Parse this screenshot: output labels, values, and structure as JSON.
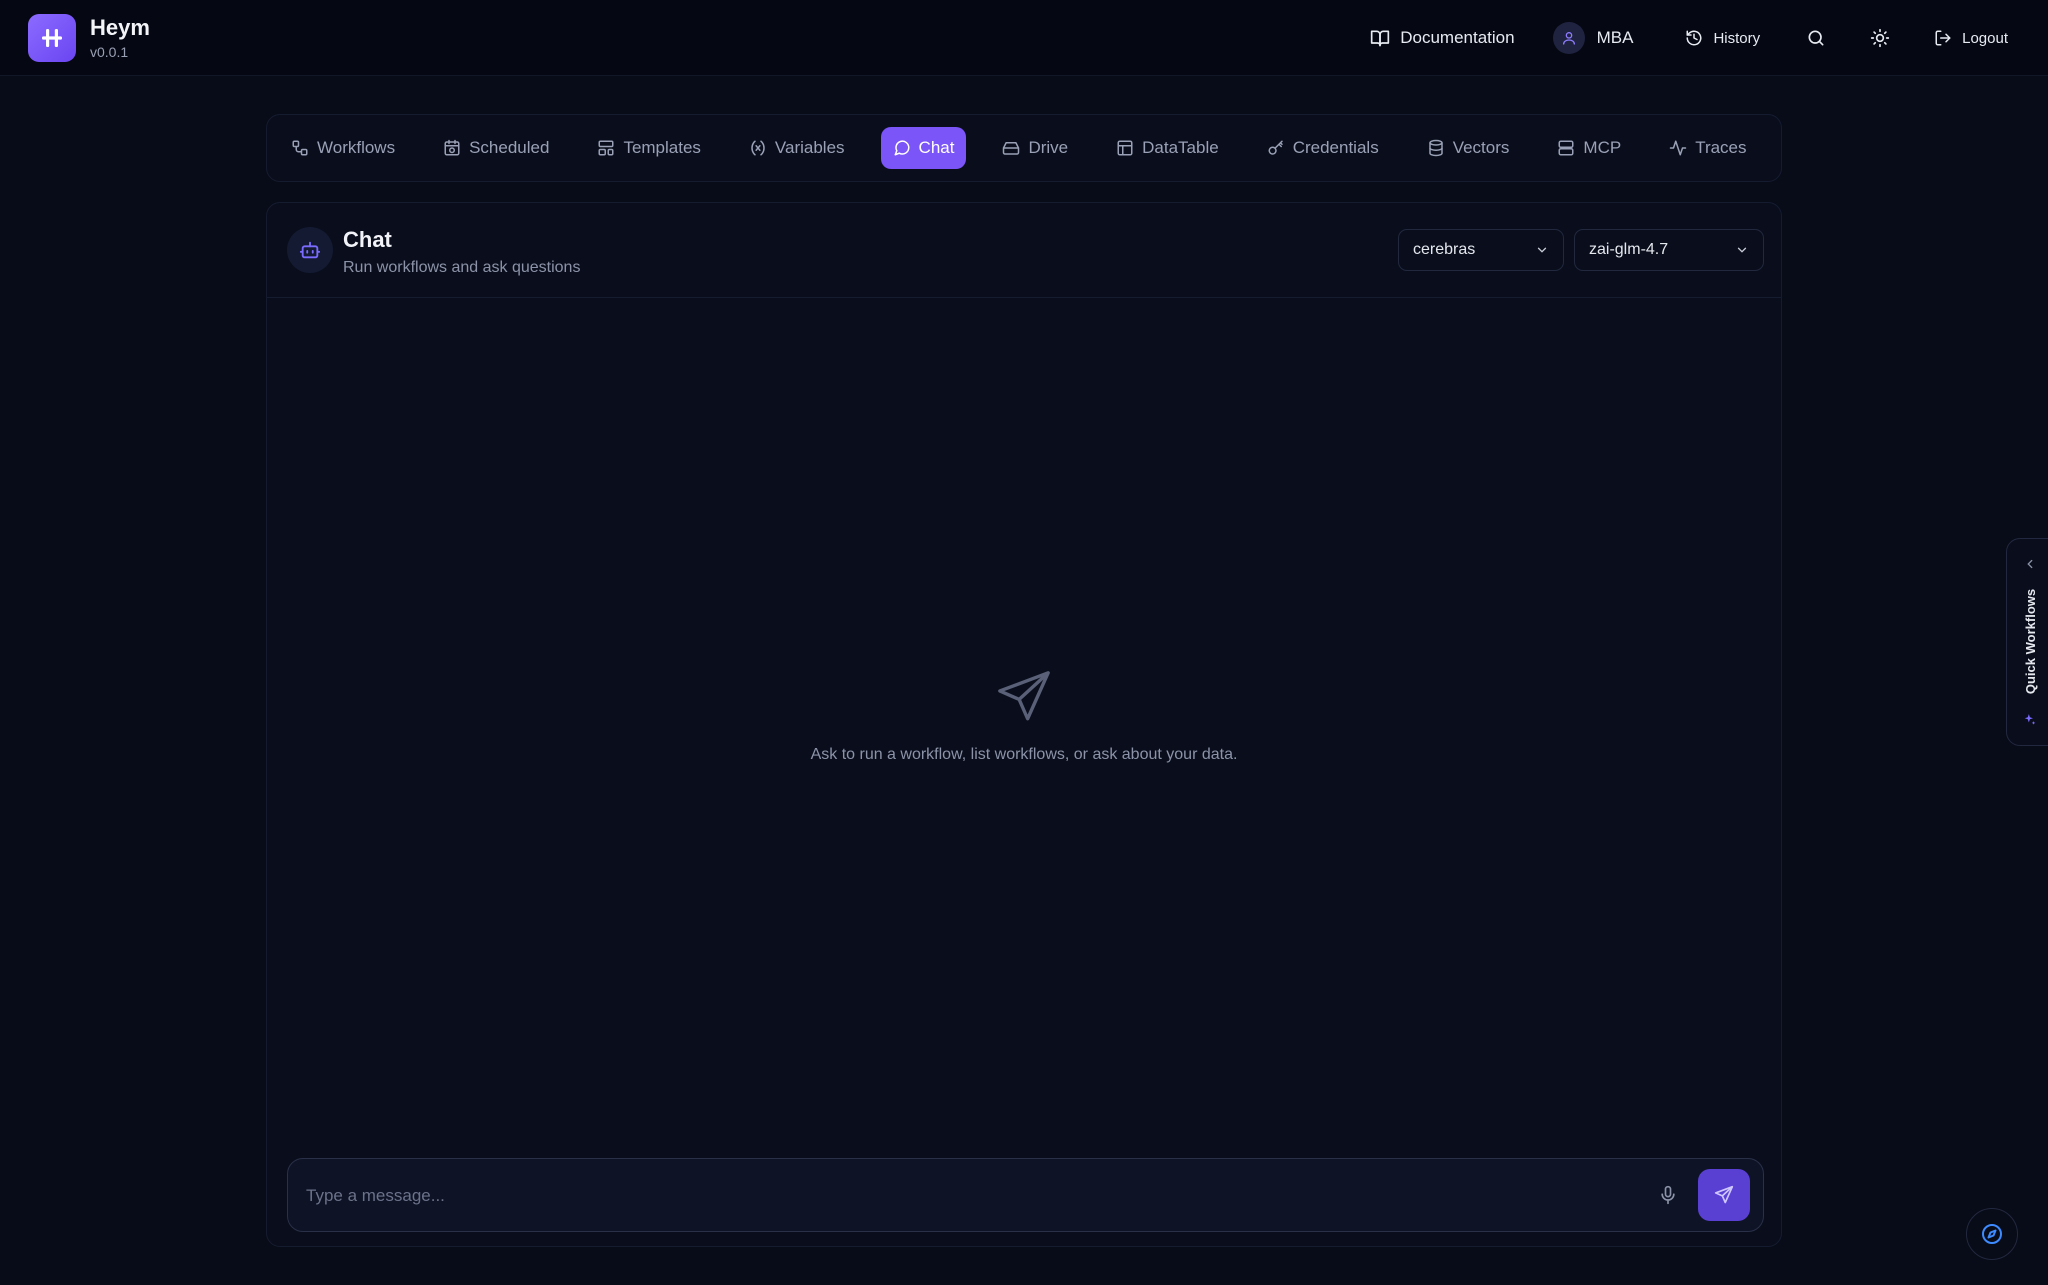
{
  "app": {
    "name": "Heym",
    "version": "v0.0.1"
  },
  "header": {
    "documentation": "Documentation",
    "user": "MBA",
    "history": "History",
    "logout": "Logout"
  },
  "tabs": [
    {
      "label": "Workflows",
      "icon": "workflow-icon"
    },
    {
      "label": "Scheduled",
      "icon": "calendar-clock-icon"
    },
    {
      "label": "Templates",
      "icon": "layout-template-icon"
    },
    {
      "label": "Variables",
      "icon": "variable-icon"
    },
    {
      "label": "Chat",
      "icon": "chat-bubble-icon",
      "active": true
    },
    {
      "label": "Drive",
      "icon": "hard-drive-icon"
    },
    {
      "label": "DataTable",
      "icon": "table-icon"
    },
    {
      "label": "Credentials",
      "icon": "key-icon"
    },
    {
      "label": "Vectors",
      "icon": "database-icon"
    },
    {
      "label": "MCP",
      "icon": "server-icon"
    },
    {
      "label": "Traces",
      "icon": "activity-icon"
    }
  ],
  "chat": {
    "title": "Chat",
    "subtitle": "Run workflows and ask questions",
    "provider": "cerebras",
    "model": "zai-glm-4.7",
    "empty_text": "Ask to run a workflow, list workflows, or ask about your data.",
    "input_placeholder": "Type a message..."
  },
  "quick_workflows": {
    "label": "Quick Workflows"
  },
  "colors": {
    "accent": "#7b55f8",
    "background": "#080b18",
    "panel": "#0a0e1c"
  }
}
